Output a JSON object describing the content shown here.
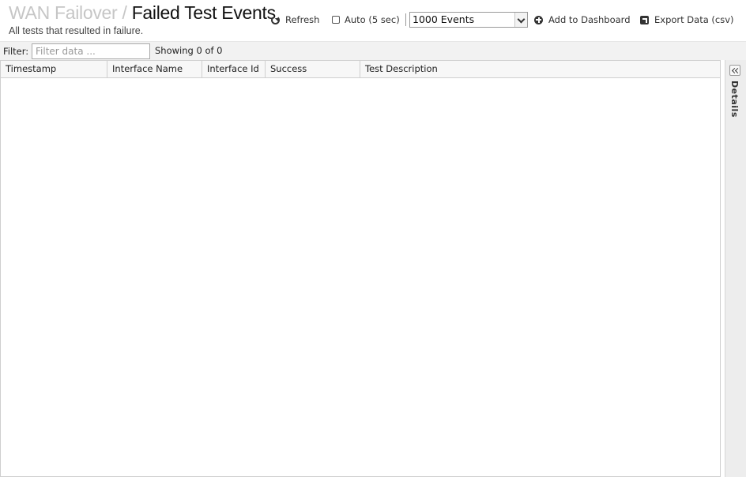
{
  "header": {
    "breadcrumb": "WAN Failover",
    "separator": "/",
    "title": "Failed Test Events",
    "subtitle": "All tests that resulted in failure."
  },
  "toolbar": {
    "refresh_label": "Refresh",
    "auto_label": "Auto (5 sec)",
    "auto_checked": false,
    "events_selected": "1000 Events",
    "add_dashboard_label": "Add to Dashboard",
    "export_label": "Export Data (csv)"
  },
  "filter": {
    "label": "Filter:",
    "placeholder": "Filter data ...",
    "value": "",
    "showing": "Showing 0 of 0"
  },
  "grid": {
    "columns": [
      {
        "label": "Timestamp"
      },
      {
        "label": "Interface Name"
      },
      {
        "label": "Interface Id"
      },
      {
        "label": "Success"
      },
      {
        "label": "Test Description"
      }
    ],
    "rows": []
  },
  "details": {
    "label": "Details"
  },
  "colors": {
    "crumb": "#c6c6c6",
    "filter_bar_bg": "#f2f2f2",
    "border": "#cfcfcf",
    "details_bg": "#ededed"
  },
  "icons": [
    "refresh-icon",
    "plus-circle-icon",
    "export-icon",
    "chevron-down-icon",
    "double-chevron-left-icon"
  ]
}
